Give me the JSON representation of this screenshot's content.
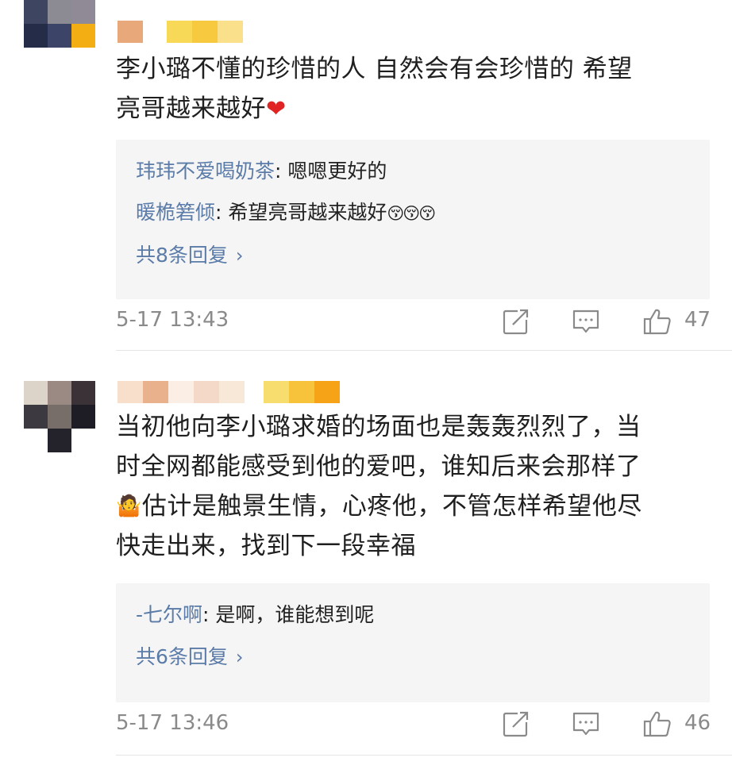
{
  "comments": [
    {
      "avatar_colors": [
        "#3e4560",
        "#8c8b94",
        "#8f8a96",
        "#252c48",
        "#3c4467",
        "#f2ae13",
        "#ffffff",
        "#ffffff",
        "#ffffff"
      ],
      "name_colors": [
        "#e8a87a",
        "#ffffff",
        "#f8d857",
        "#f7c93f",
        "#fae08a"
      ],
      "text": "李小璐不懂的珍惜的人 自然会有会珍惜的 希望亮哥越来越好",
      "replies": [
        {
          "user": "玮玮不爱喝奶茶",
          "sep": ": ",
          "text": "嗯嗯更好的",
          "emoji": ""
        },
        {
          "user": "暖桅箬倾",
          "sep": ": ",
          "text": "希望亮哥越来越好",
          "emoji": "😚😚😚"
        }
      ],
      "more_replies": "共8条回复",
      "timestamp": "5-17 13:43",
      "likes": "47"
    },
    {
      "avatar_colors": [
        "#dcd4c8",
        "#9b8a84",
        "#3a3237",
        "#3c3a40",
        "#776e6a",
        "#1e1c24",
        "#ffffff",
        "#24222a",
        "#ffffff"
      ],
      "name_colors": [
        "#f7dfcc",
        "#e9b28c",
        "#fbeee4",
        "#f4d8c8",
        "#f7e8d8",
        "#ffffff",
        "#f6dd6d",
        "#f7c33a",
        "#f6a318"
      ],
      "text_lines": [
        "当初他向李小璐求婚的场面也是轰轰烈烈了，当",
        "时全网都能感受到他的爱吧，谁知后来会那样了",
        "估计是触景生情，心疼他，不管怎样希望他尽",
        "快走出来，找到下一段幸福"
      ],
      "replies": [
        {
          "user": "-七尔啊",
          "sep": ": ",
          "text": "是啊，谁能想到呢",
          "emoji": ""
        }
      ],
      "more_replies": "共6条回复",
      "timestamp": "5-17 13:46",
      "likes": "46"
    }
  ],
  "first_comment_line2": "亮哥越来越好",
  "first_comment_line1": "李小璐不懂的珍惜的人 自然会有会珍惜的 希望",
  "heart_icon": "❤",
  "shrug_icon": "🤷",
  "chevron": "›",
  "icons": [
    "share-icon",
    "comment-icon",
    "like-icon"
  ]
}
